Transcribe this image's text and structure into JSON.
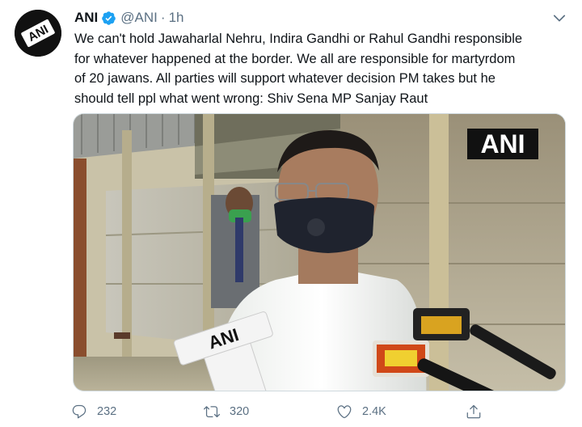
{
  "tweet": {
    "display_name": "ANI",
    "handle": "@ANI",
    "separator": "·",
    "timestamp": "1h",
    "text_lines": [
      "We can't hold Jawaharlal Nehru, Indira Gandhi or Rahul Gandhi responsible",
      "for whatever happened at the border. We all are responsible for martyrdom",
      "of 20 jawans. All parties will support whatever decision PM takes but he",
      "should tell ppl what went wrong: Shiv Sena MP Sanjay Raut"
    ],
    "media": {
      "watermark": "ANI",
      "mic_label": "ANI"
    },
    "actions": {
      "reply_count": "232",
      "retweet_count": "320",
      "like_count": "2.4K"
    }
  },
  "icons": {
    "verified": "verified-badge-icon",
    "caret": "chevron-down-icon",
    "reply": "reply-icon",
    "retweet": "retweet-icon",
    "like": "heart-icon",
    "share": "share-icon"
  },
  "colors": {
    "verified_blue": "#1da1f2",
    "secondary_text": "#5b7083",
    "primary_text": "#0f1419"
  }
}
